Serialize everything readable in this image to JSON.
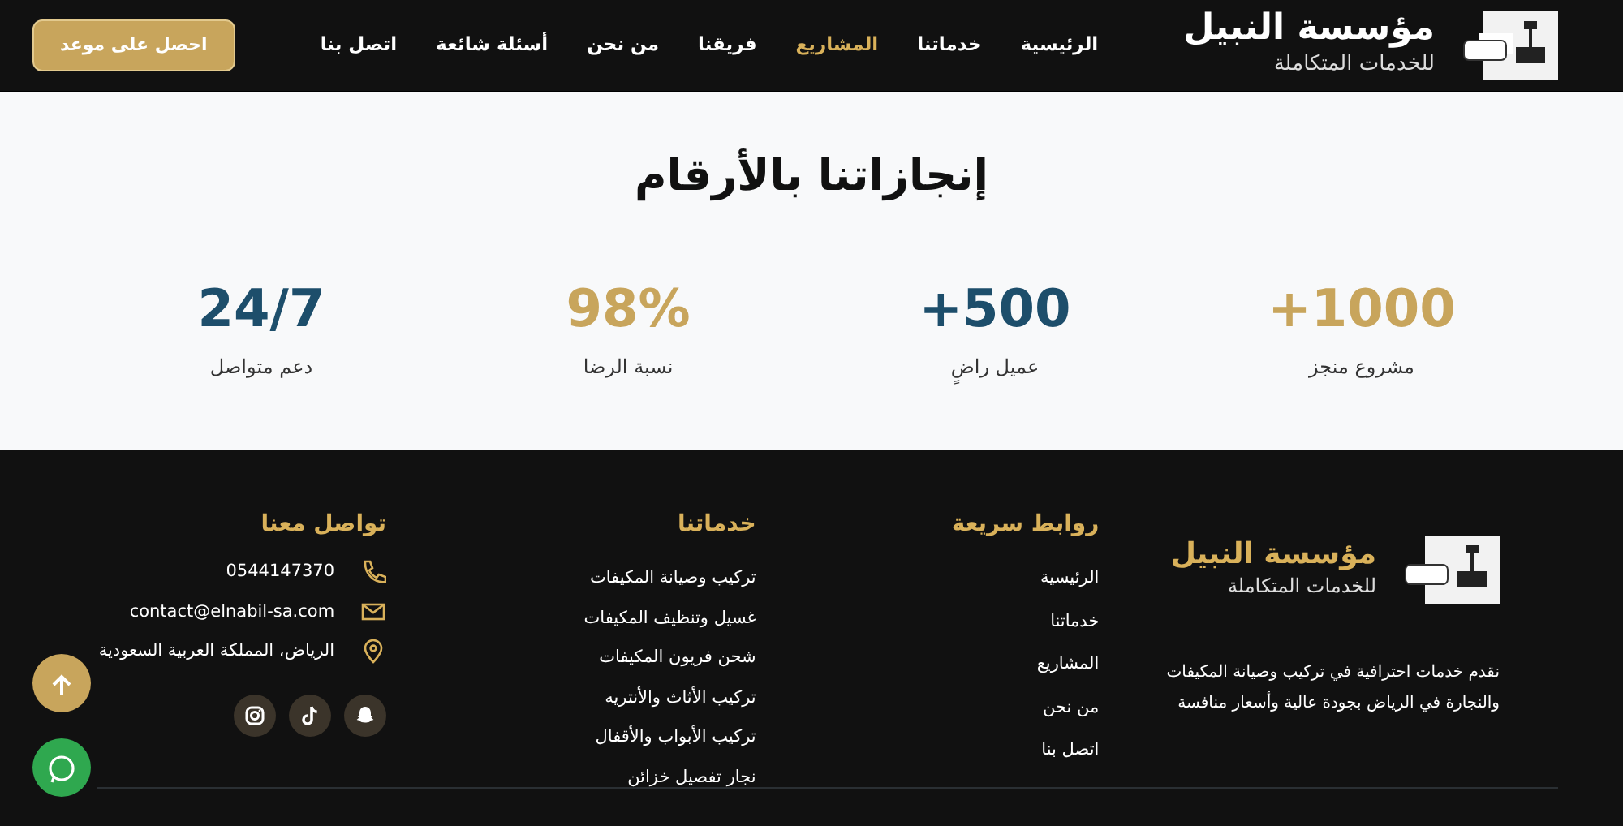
{
  "brand": {
    "name": "مؤسسة النبيل",
    "tagline": "للخدمات المتكاملة"
  },
  "nav": [
    {
      "label": "الرئيسية",
      "selected": false
    },
    {
      "label": "خدماتنا",
      "selected": false
    },
    {
      "label": "المشاريع",
      "selected": true
    },
    {
      "label": "فريقنا",
      "selected": false
    },
    {
      "label": "من نحن",
      "selected": false
    },
    {
      "label": "أسئلة شائعة",
      "selected": false
    },
    {
      "label": "اتصل بنا",
      "selected": false
    }
  ],
  "cta_button": "احصل على موعد",
  "stats": {
    "title": "إنجازاتنا بالأرقام",
    "items": [
      {
        "value": "+1000",
        "label": "مشروع منجز",
        "color": "#c8a55c"
      },
      {
        "value": "+500",
        "label": "عميل راضٍ",
        "color": "#1d4e6b"
      },
      {
        "value": "98%",
        "label": "نسبة الرضا",
        "color": "#c8a55c"
      },
      {
        "value": "24/7",
        "label": "دعم متواصل",
        "color": "#1d4e6b"
      }
    ]
  },
  "footer": {
    "brand": {
      "name": "مؤسسة النبيل",
      "tagline": "للخدمات المتكاملة"
    },
    "about": "نقدم خدمات احترافية في تركيب وصيانة المكيفات والنجارة في الرياض بجودة عالية وأسعار منافسة",
    "quick_links": {
      "title": "روابط سريعة",
      "items": [
        "الرئيسية",
        "خدماتنا",
        "المشاريع",
        "من نحن",
        "اتصل بنا"
      ]
    },
    "services": {
      "title": "خدماتنا",
      "items": [
        "تركيب وصيانة المكيفات",
        "غسيل وتنظيف المكيفات",
        "شحن فريون المكيفات",
        "تركيب الأثاث والأنتريه",
        "تركيب الأبواب والأقفال",
        "نجار تفصيل خزائن"
      ]
    },
    "contact": {
      "title": "تواصل معنا",
      "items": [
        {
          "kind": "phone",
          "text": "0544147370"
        },
        {
          "kind": "email",
          "text": "contact@elnabil-sa.com"
        },
        {
          "kind": "location",
          "text": "الرياض، المملكة العربية السعودية"
        }
      ]
    }
  }
}
